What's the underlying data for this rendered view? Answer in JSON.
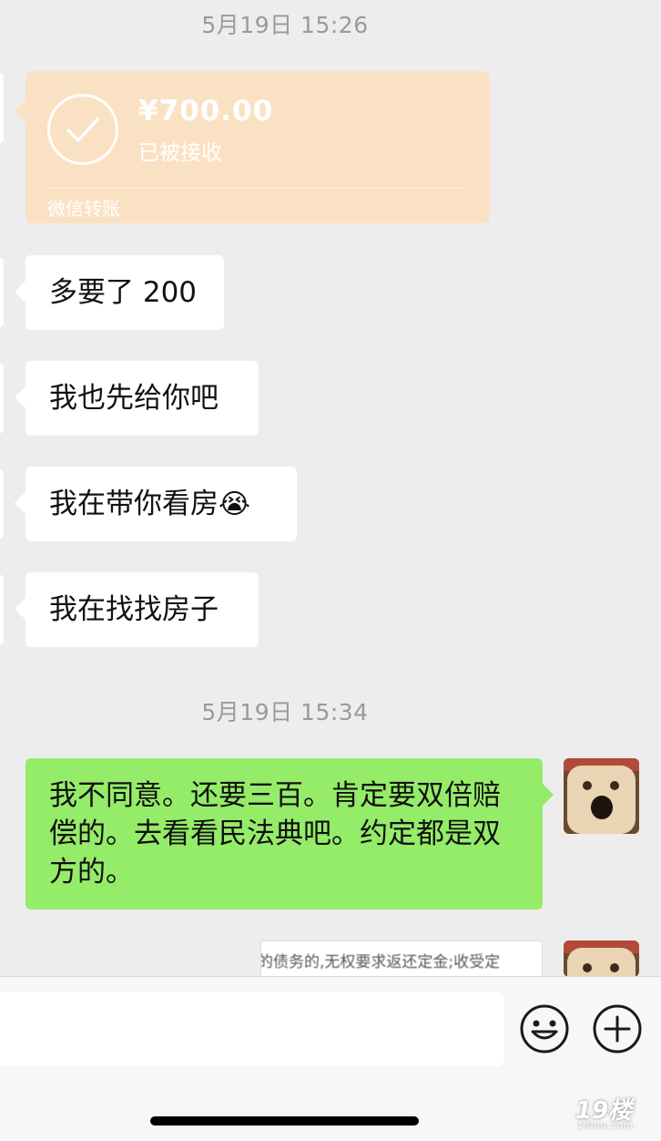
{
  "timestamps": [
    "5月19日 15:26",
    "5月19日 15:34"
  ],
  "transfer": {
    "amount": "¥700.00",
    "status": "已被接收",
    "label": "微信转账",
    "check_icon": "check-circle-icon"
  },
  "incoming_messages": [
    {
      "text": "多要了 200"
    },
    {
      "text": "我也先给你吧"
    },
    {
      "text": "我在带你看房",
      "emoji": "😭"
    },
    {
      "text": "我在找找房子"
    }
  ],
  "outgoing_messages": [
    {
      "text": "我不同意。还要三百。肯定要双倍赔偿的。去看看民法典吧。约定都是双方的。"
    }
  ],
  "image_message": {
    "preview_text": "的债务的,无权要求返还定金;收受定"
  },
  "input_bar": {
    "placeholder": "",
    "emoji_icon": "smiley-icon",
    "plus_icon": "plus-circle-icon"
  },
  "watermark": {
    "main": "19楼",
    "sub": "19lou.com"
  },
  "colors": {
    "background": "#ededed",
    "incoming_bubble": "#ffffff",
    "outgoing_bubble": "#95ec69",
    "transfer_card": "#fbe1c4"
  }
}
